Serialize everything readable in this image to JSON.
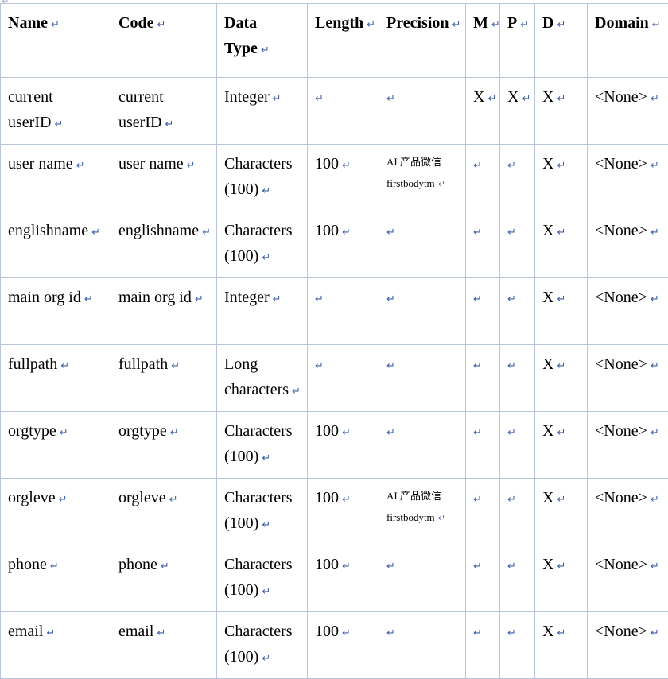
{
  "document": {
    "type": "data-dictionary-table",
    "paragraph_mark": "↵",
    "stray_mark": "↵",
    "border_color": "#b9c5d9",
    "mark_color": "#3f5fa8",
    "text_color": "#000000"
  },
  "table": {
    "columns": [
      {
        "key": "name",
        "label": "Name"
      },
      {
        "key": "code",
        "label": "Code"
      },
      {
        "key": "data_type",
        "label": "Data Type"
      },
      {
        "key": "length",
        "label": "Length"
      },
      {
        "key": "precision",
        "label": "Precision"
      },
      {
        "key": "m",
        "label": "M"
      },
      {
        "key": "p",
        "label": "P"
      },
      {
        "key": "d",
        "label": "D"
      },
      {
        "key": "domain",
        "label": "Domain"
      }
    ],
    "rows": [
      {
        "name": "current userID",
        "code": "current userID",
        "data_type": "Integer",
        "length": "",
        "precision": "",
        "precision_line2": "",
        "m": "X",
        "p": "X",
        "d": "X",
        "domain": "<None>"
      },
      {
        "name": "user name",
        "code": "user name",
        "data_type": "Characters (100)",
        "length": "100",
        "precision": "AI 产品微信",
        "precision_line2": "firstbodytm",
        "m": "",
        "p": "",
        "d": "X",
        "domain": "<None>"
      },
      {
        "name": "englishname",
        "code": "englishname",
        "data_type": "Characters (100)",
        "length": "100",
        "precision": "",
        "precision_line2": "",
        "m": "",
        "p": "",
        "d": "X",
        "domain": "<None>"
      },
      {
        "name": "main org id",
        "code": "main org id",
        "data_type": "Integer",
        "length": "",
        "precision": "",
        "precision_line2": "",
        "m": "",
        "p": "",
        "d": "X",
        "domain": "<None>"
      },
      {
        "name": "fullpath",
        "code": "fullpath",
        "data_type": "Long characters",
        "length": "",
        "precision": "",
        "precision_line2": "",
        "m": "",
        "p": "",
        "d": "X",
        "domain": "<None>"
      },
      {
        "name": "orgtype",
        "code": "orgtype",
        "data_type": "Characters (100)",
        "length": "100",
        "precision": "",
        "precision_line2": "",
        "m": "",
        "p": "",
        "d": "X",
        "domain": "<None>"
      },
      {
        "name": "orgleve",
        "code": "orgleve",
        "data_type": "Characters (100)",
        "length": "100",
        "precision": "AI 产品微信",
        "precision_line2": "firstbodytm",
        "m": "",
        "p": "",
        "d": "X",
        "domain": "<None>"
      },
      {
        "name": "phone",
        "code": "phone",
        "data_type": "Characters (100)",
        "length": "100",
        "precision": "",
        "precision_line2": "",
        "m": "",
        "p": "",
        "d": "X",
        "domain": "<None>"
      },
      {
        "name": "email",
        "code": "email",
        "data_type": "Characters (100)",
        "length": "100",
        "precision": "",
        "precision_line2": "",
        "m": "",
        "p": "",
        "d": "X",
        "domain": "<None>"
      }
    ]
  }
}
